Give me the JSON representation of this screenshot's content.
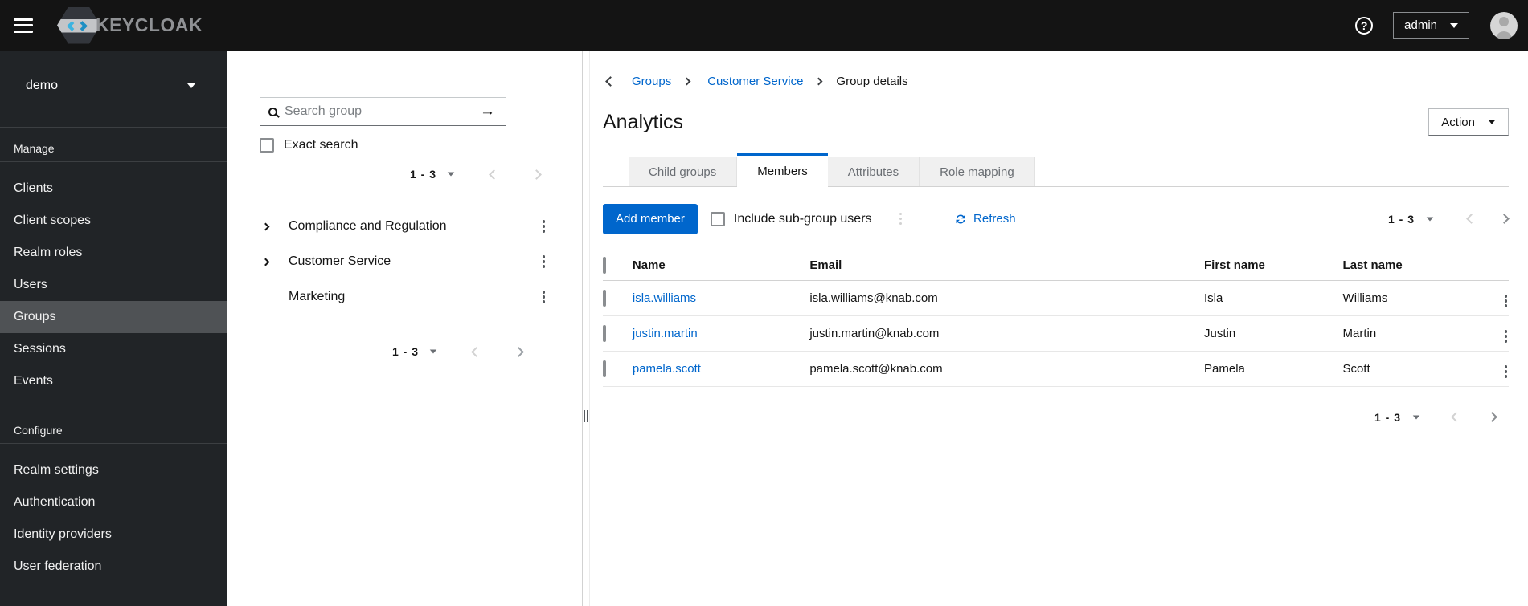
{
  "accent_color": "#0066cc",
  "masthead": {
    "brand": "KEYCLOAK",
    "user_menu": "admin"
  },
  "sidebar": {
    "realm": "demo",
    "sections": [
      {
        "label": "Manage",
        "items": [
          "Clients",
          "Client scopes",
          "Realm roles",
          "Users",
          "Groups",
          "Sessions",
          "Events"
        ],
        "active_item": "Groups"
      },
      {
        "label": "Configure",
        "items": [
          "Realm settings",
          "Authentication",
          "Identity providers",
          "User federation"
        ]
      }
    ]
  },
  "tree": {
    "search_placeholder": "Search group",
    "exact_label": "Exact search",
    "pagination_top": {
      "range": "1 - 3"
    },
    "groups": [
      {
        "name": "Compliance and Regulation",
        "expandable": true
      },
      {
        "name": "Customer Service",
        "expandable": true
      },
      {
        "name": "Marketing",
        "expandable": false
      }
    ],
    "pagination_bottom": {
      "range": "1 - 3"
    }
  },
  "breadcrumb": {
    "items": [
      "Groups",
      "Customer Service",
      "Group details"
    ]
  },
  "page": {
    "title": "Analytics",
    "action_label": "Action",
    "tabs": [
      "Child groups",
      "Members",
      "Attributes",
      "Role mapping"
    ],
    "active_tab": "Members"
  },
  "toolbar": {
    "add_member_label": "Add member",
    "include_label": "Include sub-group users",
    "refresh_label": "Refresh",
    "pagination": {
      "range": "1 - 3"
    }
  },
  "table": {
    "headers": [
      "Name",
      "Email",
      "First name",
      "Last name"
    ],
    "rows": [
      {
        "name": "isla.williams",
        "email": "isla.williams@knab.com",
        "first": "Isla",
        "last": "Williams"
      },
      {
        "name": "justin.martin",
        "email": "justin.martin@knab.com",
        "first": "Justin",
        "last": "Martin"
      },
      {
        "name": "pamela.scott",
        "email": "pamela.scott@knab.com",
        "first": "Pamela",
        "last": "Scott"
      }
    ],
    "pagination": {
      "range": "1 - 3"
    }
  }
}
